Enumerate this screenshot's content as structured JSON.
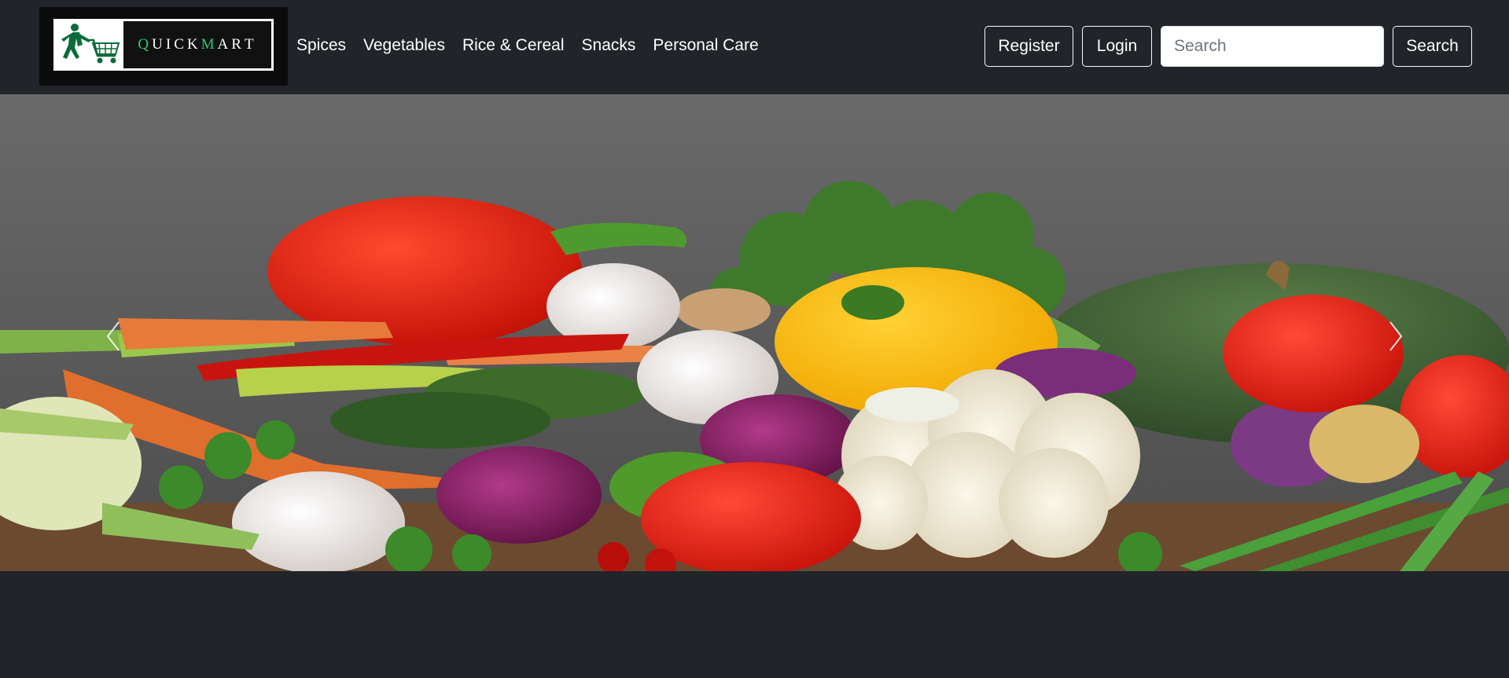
{
  "brand": {
    "logo_letters": [
      "Q",
      "U",
      "I",
      "C",
      "K",
      "M",
      "A",
      "R",
      "T"
    ],
    "accent_color": "#2ecc71",
    "logo_icon": "running-man-cart-icon"
  },
  "nav": {
    "links": [
      "Spices",
      "Vegetables",
      "Rice & Cereal",
      "Snacks",
      "Personal Care"
    ]
  },
  "header": {
    "register_label": "Register",
    "login_label": "Login",
    "search_placeholder": "Search",
    "search_value": "",
    "search_button_label": "Search"
  },
  "carousel": {
    "image_subject": "assorted fresh vegetables",
    "prev_icon": "chevron-left-icon",
    "next_icon": "chevron-right-icon"
  },
  "colors": {
    "page_bg": "#212529",
    "nav_text": "#ffffff"
  }
}
